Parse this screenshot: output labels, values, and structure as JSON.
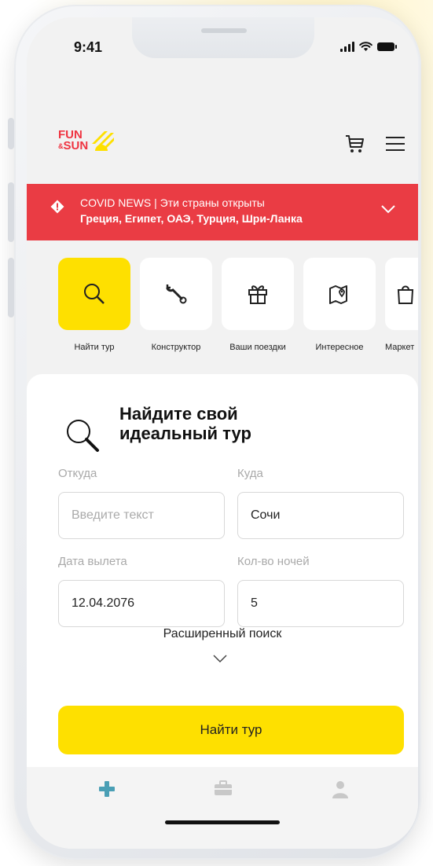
{
  "status": {
    "time": "9:41"
  },
  "brand": {
    "logo_line1": "FUN",
    "logo_amp": "&",
    "logo_line2": "SUN",
    "red": "#ea3c44",
    "yellow": "#fee000"
  },
  "header": {
    "icons": [
      "cart-icon",
      "menu-icon"
    ]
  },
  "covid": {
    "line1": "COVID NEWS | Эти страны открыты",
    "line2": "Греция, Египет, ОАЭ, Турция, Шри-Ланка"
  },
  "quick_actions": [
    {
      "label": "Найти тур",
      "icon": "search-icon",
      "active": true
    },
    {
      "label": "Конструктор",
      "icon": "wrench-icon",
      "active": false
    },
    {
      "label": "Ваши поездки",
      "icon": "gift-icon",
      "active": false
    },
    {
      "label": "Интересное",
      "icon": "map-pin-icon",
      "active": false
    },
    {
      "label": "Маркет",
      "icon": "shopping-bag-icon",
      "active": false
    }
  ],
  "search": {
    "title": "Найдите свой идеальный тур",
    "from_label": "Откуда",
    "from_placeholder": "Введите текст",
    "from_value": "",
    "to_label": "Куда",
    "to_value": "Сочи",
    "date_label": "Дата вылета",
    "date_value": "12.04.2076",
    "nights_label": "Кол-во ночей",
    "nights_value": "5",
    "advanced_label": "Расширенный поиск",
    "submit_label": "Найти тур"
  },
  "tabbar": {
    "tabs": [
      "plus-icon",
      "briefcase-icon",
      "profile-icon"
    ],
    "active_color": "#4a9fb5"
  }
}
